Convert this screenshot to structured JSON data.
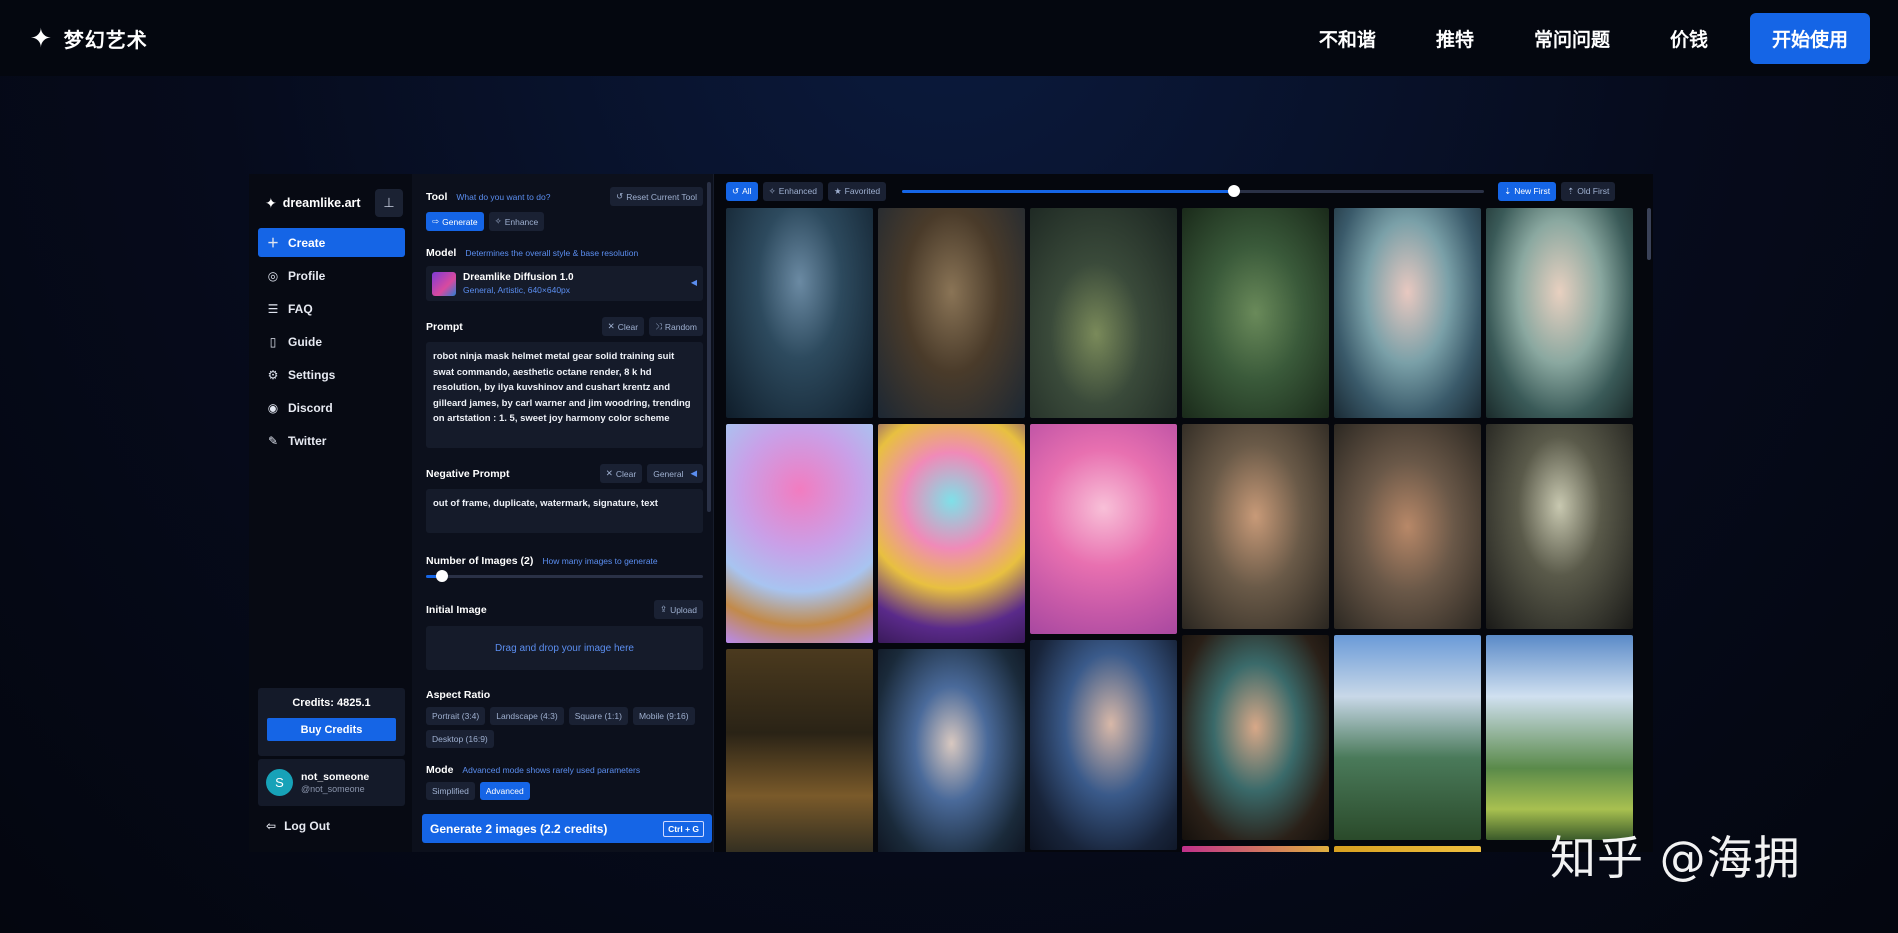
{
  "site": {
    "brand": "梦幻艺术",
    "nav": [
      "不和谐",
      "推特",
      "常问问题",
      "价钱"
    ],
    "cta": "开始使用"
  },
  "sidebar": {
    "app_name": "dreamlike.art",
    "items": [
      {
        "label": "Create",
        "icon": "plus-icon",
        "active": true
      },
      {
        "label": "Profile",
        "icon": "user-circle-icon"
      },
      {
        "label": "FAQ",
        "icon": "list-icon"
      },
      {
        "label": "Guide",
        "icon": "book-icon"
      },
      {
        "label": "Settings",
        "icon": "gear-icon"
      },
      {
        "label": "Discord",
        "icon": "discord-icon"
      },
      {
        "label": "Twitter",
        "icon": "twitter-icon"
      }
    ],
    "credits_label": "Credits: 4825.1",
    "buy_credits": "Buy Credits",
    "user": {
      "initial": "S",
      "name": "not_someone",
      "handle": "@not_someone"
    },
    "logout": "Log Out"
  },
  "panel": {
    "tool": {
      "label": "Tool",
      "hint": "What do you want to do?",
      "reset": "Reset Current Tool",
      "options": [
        "Generate",
        "Enhance"
      ],
      "selected": "Generate"
    },
    "model": {
      "label": "Model",
      "hint": "Determines the overall style & base resolution",
      "name": "Dreamlike Diffusion 1.0",
      "desc": "General, Artistic, 640×640px"
    },
    "prompt": {
      "label": "Prompt",
      "clear": "Clear",
      "random": "Random",
      "text": "robot ninja mask helmet metal gear solid training suit swat commando, aesthetic octane render, 8 k hd resolution, by ilya kuvshinov and cushart krentz and gilleard james, by carl warner and jim woodring, trending on artstation : 1. 5, sweet joy harmony color scheme"
    },
    "negative": {
      "label": "Negative Prompt",
      "clear": "Clear",
      "preset": "General",
      "text": "out of frame, duplicate, watermark, signature, text"
    },
    "num_images": {
      "label": "Number of Images (2)",
      "hint": "How many images to generate",
      "value": 2
    },
    "initial_image": {
      "label": "Initial Image",
      "upload": "Upload",
      "drop": "Drag and drop your image here"
    },
    "aspect": {
      "label": "Aspect Ratio",
      "options": [
        "Portrait (3:4)",
        "Landscape (4:3)",
        "Square (1:1)",
        "Mobile (9:16)",
        "Desktop (16:9)"
      ]
    },
    "mode": {
      "label": "Mode",
      "hint": "Advanced mode shows rarely used parameters",
      "options": [
        "Simplified",
        "Advanced"
      ],
      "selected": "Advanced"
    },
    "generate": {
      "label": "Generate 2 images (2.2 credits)",
      "shortcut": "Ctrl + G"
    }
  },
  "gallery": {
    "filters": [
      "All",
      "Enhanced",
      "Favorited"
    ],
    "selected_filter": "All",
    "sort": [
      "New First",
      "Old First"
    ],
    "selected_sort": "New First",
    "zoom_fraction": 0.57
  },
  "watermark": "知乎 @海拥"
}
